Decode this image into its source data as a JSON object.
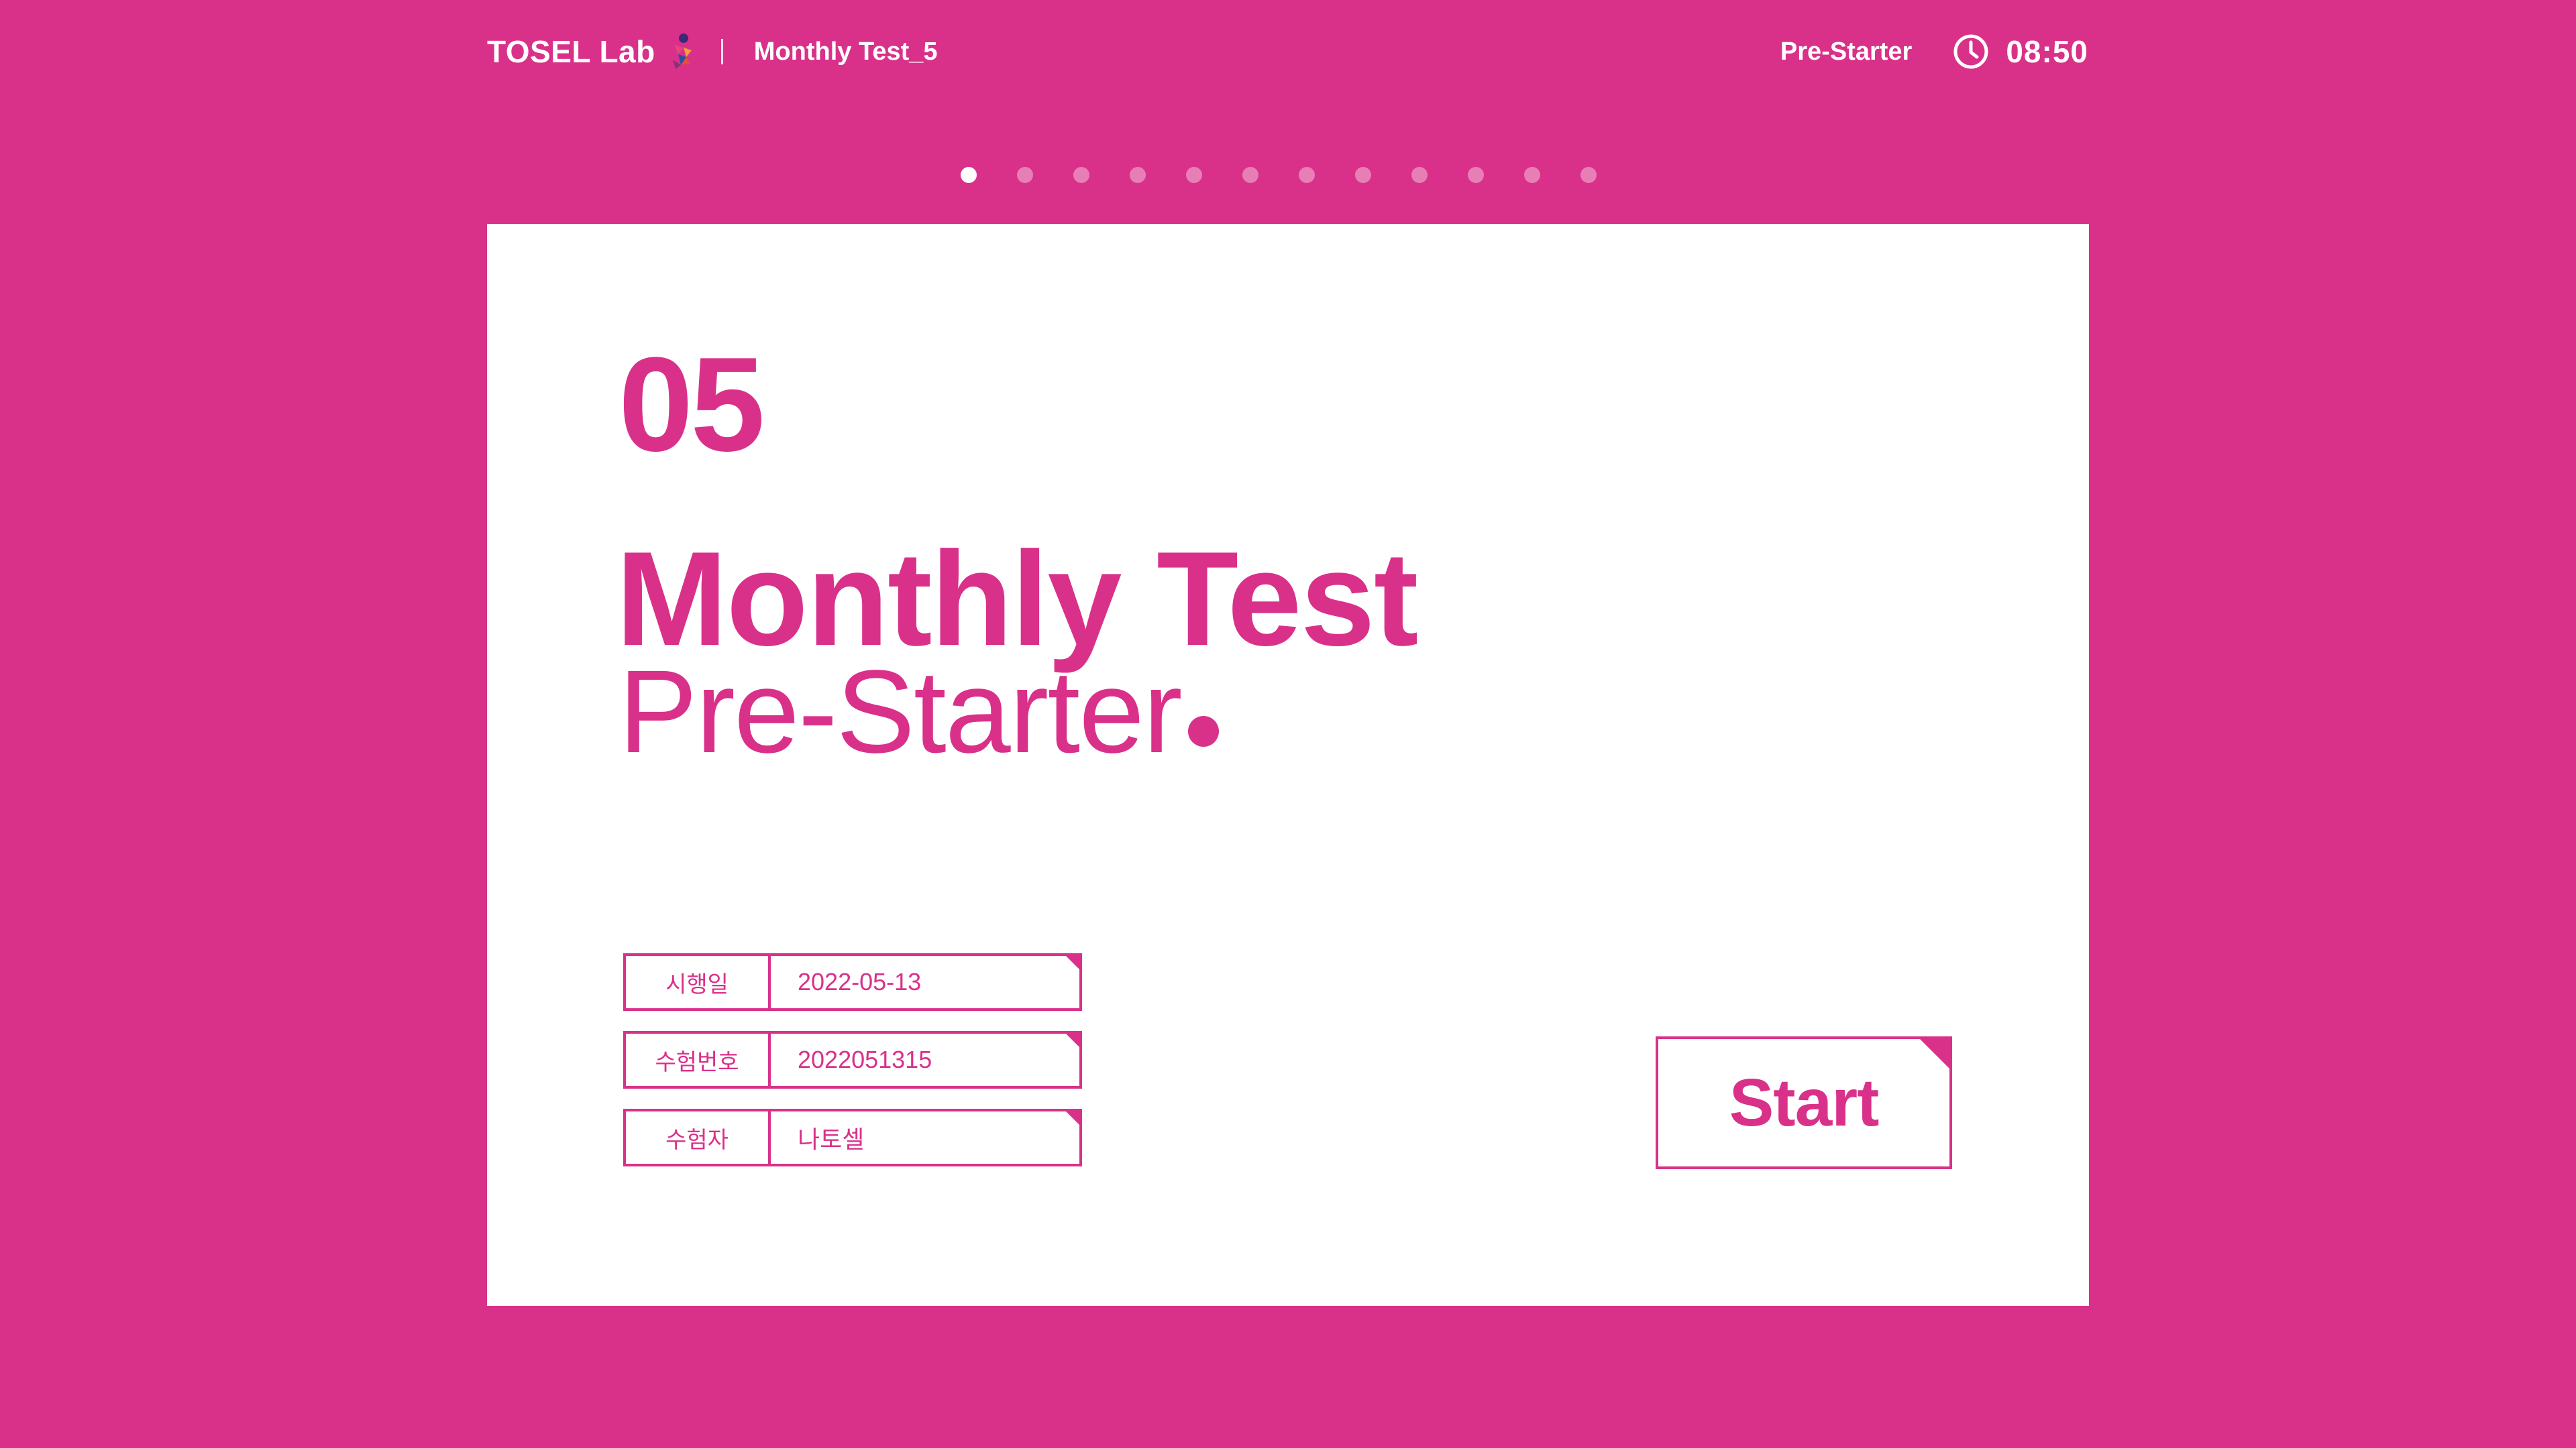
{
  "colors": {
    "background": "#d9318a",
    "card": "#ffffff",
    "accent": "#d9318a"
  },
  "header": {
    "brand": "TOSEL Lab",
    "logo_icon": "tosel-lab-logo-icon",
    "test_name": "Monthly Test_5",
    "level": "Pre-Starter",
    "clock_icon": "clock-icon",
    "timer": "08:50"
  },
  "progress": {
    "total": 12,
    "current": 1
  },
  "card": {
    "number": "05",
    "title": "Monthly Test",
    "subtitle": "Pre-Starter",
    "info": [
      {
        "label": "시행일",
        "value": "2022-05-13"
      },
      {
        "label": "수험번호",
        "value": "2022051315"
      },
      {
        "label": "수험자",
        "value": "나토셀"
      }
    ],
    "start_label": "Start"
  }
}
